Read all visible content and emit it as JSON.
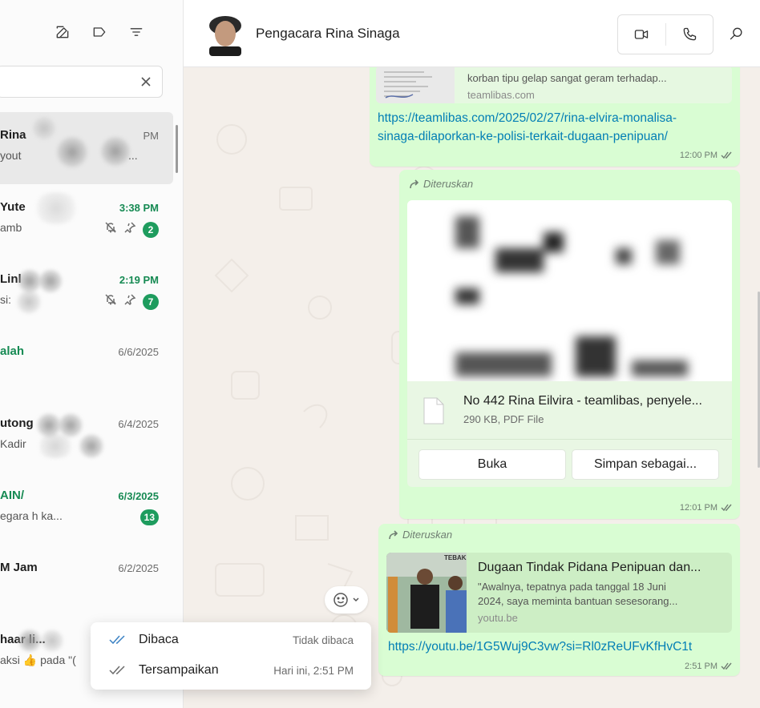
{
  "sidebar": {
    "search": {
      "value": "",
      "placeholder": ""
    },
    "chats": [
      {
        "name": "Rina",
        "time": "PM",
        "preview": "yout",
        "unread": "",
        "active": true
      },
      {
        "name": "Yute",
        "time": "3:38 PM",
        "preview": "amb",
        "unread": "2",
        "muted": true,
        "pinned": true
      },
      {
        "name": "Linl",
        "time": "2:19 PM",
        "preview": "si:",
        "unread": "7",
        "muted": true,
        "pinned": true
      },
      {
        "name": "alah",
        "time": "6/6/2025",
        "preview": ""
      },
      {
        "name": "utong",
        "time": "6/4/2025",
        "preview": "Kadir"
      },
      {
        "name": "AIN/",
        "time": "6/3/2025",
        "preview": "egara           h ka...",
        "unread": "13"
      },
      {
        "name": "M Jam",
        "time": "6/2/2025",
        "preview": ""
      },
      {
        "name": "haar         li...",
        "time": "",
        "preview": "aksi 👍 pada \"("
      }
    ],
    "active_preview_tail": "..."
  },
  "header": {
    "contact_name": "Pengacara Rina Sinaga"
  },
  "messages": {
    "m1": {
      "card_desc": "korban tipu gelap sangat geram terhadap...",
      "card_domain": "teamlibas.com",
      "link_line1": "https://teamlibas.com/2025/02/27/rina-elvira-monalisa-",
      "link_line2": "sinaga-dilaporkan-ke-polisi-terkait-dugaan-penipuan/",
      "time": "12:00 PM"
    },
    "m2": {
      "forwarded": "Diteruskan",
      "file_name": "No 442 Rina Eilvira - teamlibas, penyele...",
      "file_meta": "290 KB, PDF File",
      "open_label": "Buka",
      "save_label": "Simpan sebagai...",
      "time": "12:01 PM"
    },
    "m3": {
      "forwarded": "Diteruskan",
      "card_title": "Dugaan Tindak Pidana Penipuan dan...",
      "card_desc_1": "\"Awalnya, tepatnya pada tanggal 18 Juni",
      "card_desc_2": "2024, saya meminta bantuan sesesorang...",
      "card_domain": "youtu.be",
      "thumb_text": "TEBAK",
      "link": "https://youtu.be/1G5Wuj9C3vw?si=Rl0zReUFvKfHvC1t",
      "time": "2:51 PM"
    }
  },
  "popup": {
    "read_label": "Dibaca",
    "read_value": "Tidak dibaca",
    "delivered_label": "Tersampaikan",
    "delivered_value": "Hari ini, 2:51 PM"
  },
  "colors": {
    "accent": "#168a53",
    "bubble": "#d9fdd3",
    "link": "#027eb5",
    "read_tick": "#3b82c4"
  }
}
